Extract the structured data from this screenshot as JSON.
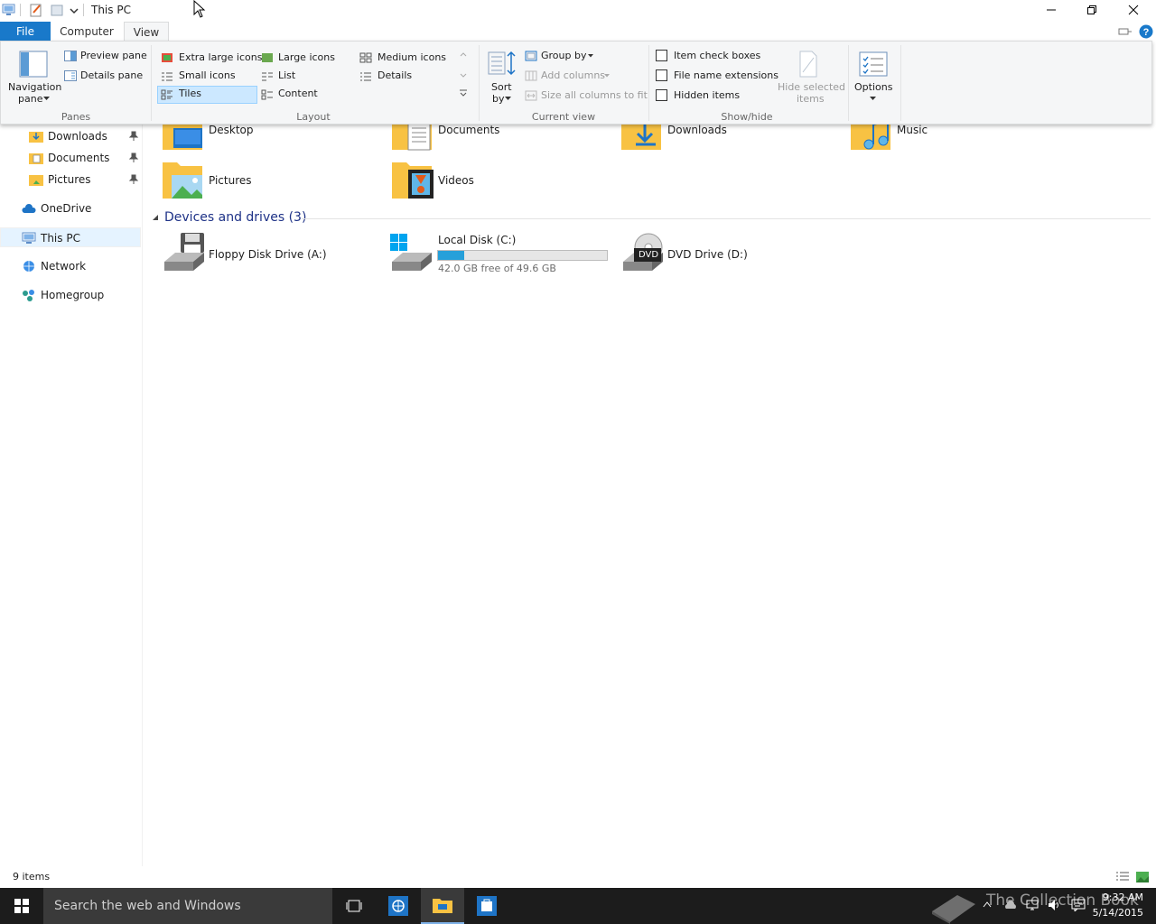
{
  "window": {
    "title": "This PC"
  },
  "ribbon": {
    "tabs": {
      "file": "File",
      "computer": "Computer",
      "view": "View"
    },
    "panes": {
      "navigation_pane": "Navigation",
      "navigation_pane_line2": "pane",
      "preview_pane": "Preview pane",
      "details_pane": "Details pane",
      "group_label": "Panes"
    },
    "layout": {
      "extra_large_icons": "Extra large icons",
      "large_icons": "Large icons",
      "medium_icons": "Medium icons",
      "small_icons": "Small icons",
      "list": "List",
      "details": "Details",
      "tiles": "Tiles",
      "content": "Content",
      "selected": "Tiles",
      "group_label": "Layout"
    },
    "current_view": {
      "sort_by": "Sort",
      "sort_by_line2": "by",
      "group_by": "Group by",
      "add_columns": "Add columns",
      "size_all_columns": "Size all columns to fit",
      "group_label": "Current view"
    },
    "show_hide": {
      "item_check_boxes": "Item check boxes",
      "file_name_extensions": "File name extensions",
      "hidden_items": "Hidden items",
      "hide_selected_items": "Hide selected",
      "hide_selected_items_line2": "items",
      "group_label": "Show/hide",
      "item_check_boxes_checked": false,
      "file_name_extensions_checked": false,
      "hidden_items_checked": false
    },
    "options": {
      "label": "Options"
    }
  },
  "nav": {
    "quick_access": [
      {
        "label": "Downloads",
        "pinned": true
      },
      {
        "label": "Documents",
        "pinned": true
      },
      {
        "label": "Pictures",
        "pinned": true
      }
    ],
    "onedrive": "OneDrive",
    "this_pc": "This PC",
    "network": "Network",
    "homegroup": "Homegroup",
    "selected": "This PC"
  },
  "content": {
    "folders": [
      {
        "label": "Desktop"
      },
      {
        "label": "Documents"
      },
      {
        "label": "Downloads"
      },
      {
        "label": "Music"
      },
      {
        "label": "Pictures"
      },
      {
        "label": "Videos"
      }
    ],
    "devices_header": "Devices and drives (3)",
    "drives": {
      "floppy": {
        "label": "Floppy Disk Drive (A:)"
      },
      "local_disk": {
        "label": "Local Disk (C:)",
        "free_text": "42.0 GB free of 49.6 GB",
        "used_fraction": 0.153
      },
      "dvd": {
        "label": "DVD Drive (D:)",
        "badge": "DVD"
      }
    }
  },
  "status": {
    "item_count": "9 items"
  },
  "taskbar": {
    "search_placeholder": "Search the web and Windows",
    "time": "9:32 AM",
    "date": "5/14/2015",
    "watermark": "The Collection Book"
  },
  "colors": {
    "accent": "#1979ca",
    "section_title": "#1e3287",
    "progress": "#26a0da",
    "folder": "#f8c243",
    "taskbar": "#1c1c1c"
  }
}
